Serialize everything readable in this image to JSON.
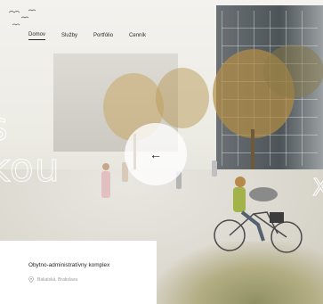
{
  "nav": {
    "items": [
      {
        "label": "Domov",
        "active": true
      },
      {
        "label": "Služby",
        "active": false
      },
      {
        "label": "Portfólio",
        "active": false
      },
      {
        "label": "Cenník",
        "active": false
      }
    ]
  },
  "hero": {
    "heading_lines": [
      "s",
      "kou"
    ],
    "right_fragment": "X",
    "slider_arrow": "←"
  },
  "project": {
    "title": "Obytno-administratívny komplex",
    "location": "Bakalská, Bratislava"
  },
  "colors": {
    "card_background": "#ffffff",
    "text_dark": "#1f1f1f",
    "text_muted": "#9a9a9a"
  },
  "icons": [
    "birds-icon",
    "arrow-left-icon",
    "location-pin-icon"
  ]
}
